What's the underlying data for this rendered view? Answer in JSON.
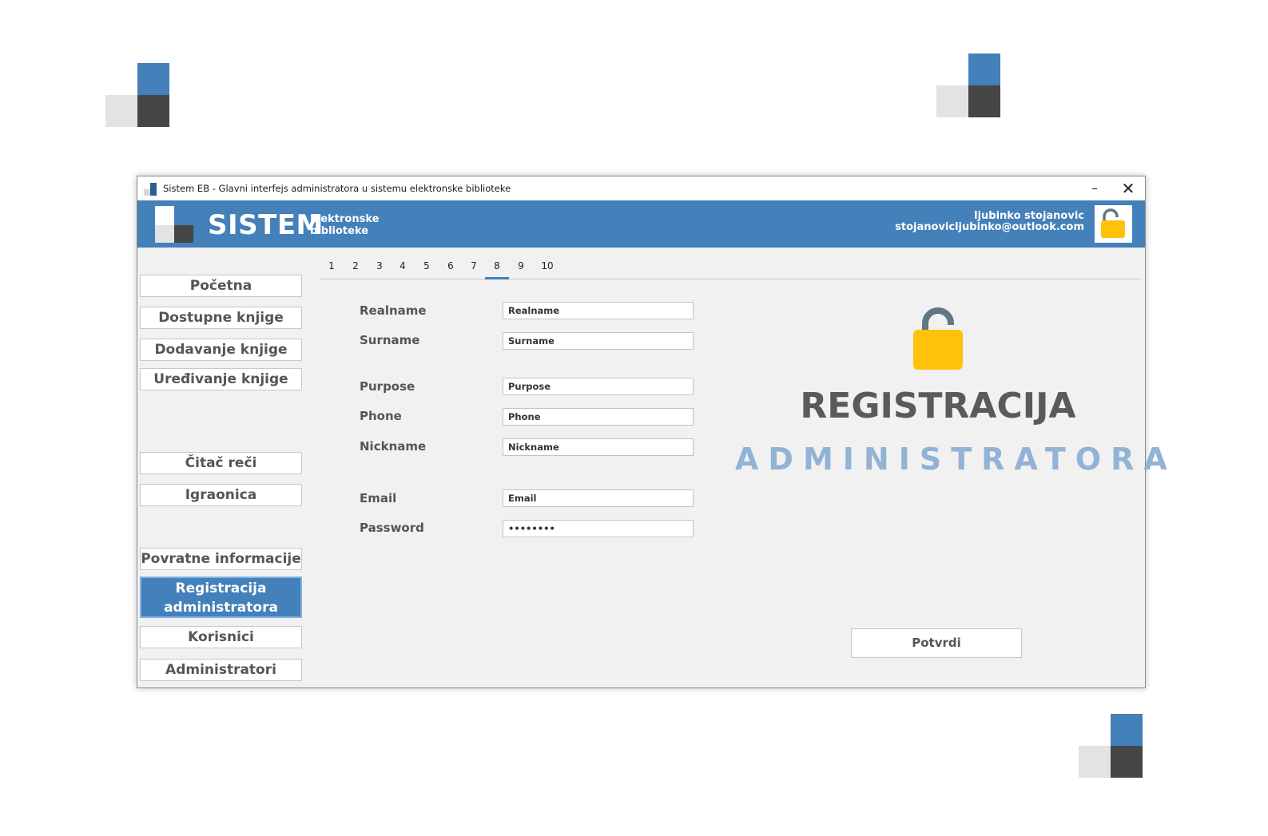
{
  "window": {
    "title": "Sistem EB - Glavni interfejs administratora u sistemu elektronske biblioteke",
    "minimize_glyph": "–",
    "close_glyph": "✕"
  },
  "header": {
    "brand": "SISTEM",
    "subtitle_line1": "Elektronske",
    "subtitle_line2": "biblioteke",
    "user_name": "ljubinko stojanovic",
    "user_email": "stojanovicljubinko@outlook.com",
    "lock_icon": "lock-open-icon",
    "accent_color": "#4480b9"
  },
  "sidebar": {
    "items": [
      {
        "label": "Početna"
      },
      {
        "label": "Dostupne knjige"
      },
      {
        "label": "Dodavanje knjige"
      },
      {
        "label": "Uređivanje knjige"
      },
      {
        "label": "Čitač reči"
      },
      {
        "label": "Igraonica"
      },
      {
        "label": "Povratne informacije"
      },
      {
        "label": "Registracija administratora"
      },
      {
        "label": "Korisnici"
      },
      {
        "label": "Administratori"
      }
    ],
    "active_index": 7
  },
  "tabs": [
    "1",
    "2",
    "3",
    "4",
    "5",
    "6",
    "7",
    "8",
    "9",
    "10"
  ],
  "active_tab": "8",
  "form": {
    "realname": {
      "label": "Realname",
      "value": "Realname"
    },
    "surname": {
      "label": "Surname",
      "value": "Surname"
    },
    "purpose": {
      "label": "Purpose",
      "value": "Purpose"
    },
    "phone": {
      "label": "Phone",
      "value": "Phone"
    },
    "nickname": {
      "label": "Nickname",
      "value": "Nickname"
    },
    "email": {
      "label": "Email",
      "value": "Email"
    },
    "password": {
      "label": "Password",
      "value": "••••••••"
    }
  },
  "panel": {
    "icon": "lock-open-icon",
    "title": "REGISTRACIJA",
    "subtitle": "ADMINISTRATORA",
    "submit_label": "Potvrdi"
  },
  "colors": {
    "lock_yellow": "#fec20a",
    "shackle": "#5f7783",
    "subtitle": "#92b2d6"
  }
}
